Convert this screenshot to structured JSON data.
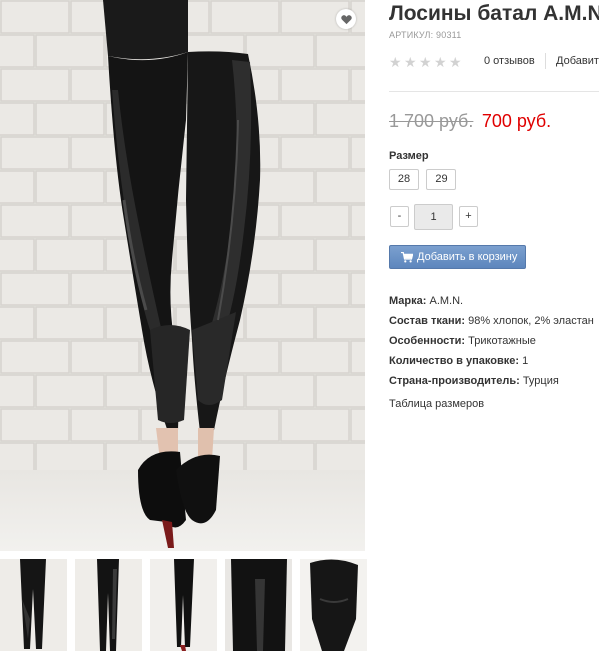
{
  "product": {
    "title": "Лосины батал A.M.N.",
    "sku_label": "Артикул:",
    "sku_value": "90311",
    "rating": 0,
    "rating_max": 5,
    "reviews_label": "0 отзывов",
    "add_review_label": "Добавить"
  },
  "price": {
    "old": "1 700 руб.",
    "new": "700 руб.",
    "old_color": "#999999",
    "new_color": "#e00000"
  },
  "size": {
    "label": "Размер",
    "options": [
      "28",
      "29"
    ]
  },
  "quantity": {
    "minus": "-",
    "value": "1",
    "plus": "+"
  },
  "cart": {
    "button_label": "Добавить в корзину",
    "button_color": "#6690c6",
    "icon": "cart-icon"
  },
  "attributes": [
    {
      "name": "Марка:",
      "value": "A.M.N."
    },
    {
      "name": "Состав ткани:",
      "value": "98% хлопок, 2% эластан"
    },
    {
      "name": "Особенности:",
      "value": "Трикотажные"
    },
    {
      "name": "Количество в упаковке:",
      "value": "1"
    },
    {
      "name": "Страна-производитель:",
      "value": "Турция"
    }
  ],
  "size_table_link": "Таблица размеров",
  "wishlist": {
    "icon": "heart-icon"
  },
  "thumbnails_count": 5
}
